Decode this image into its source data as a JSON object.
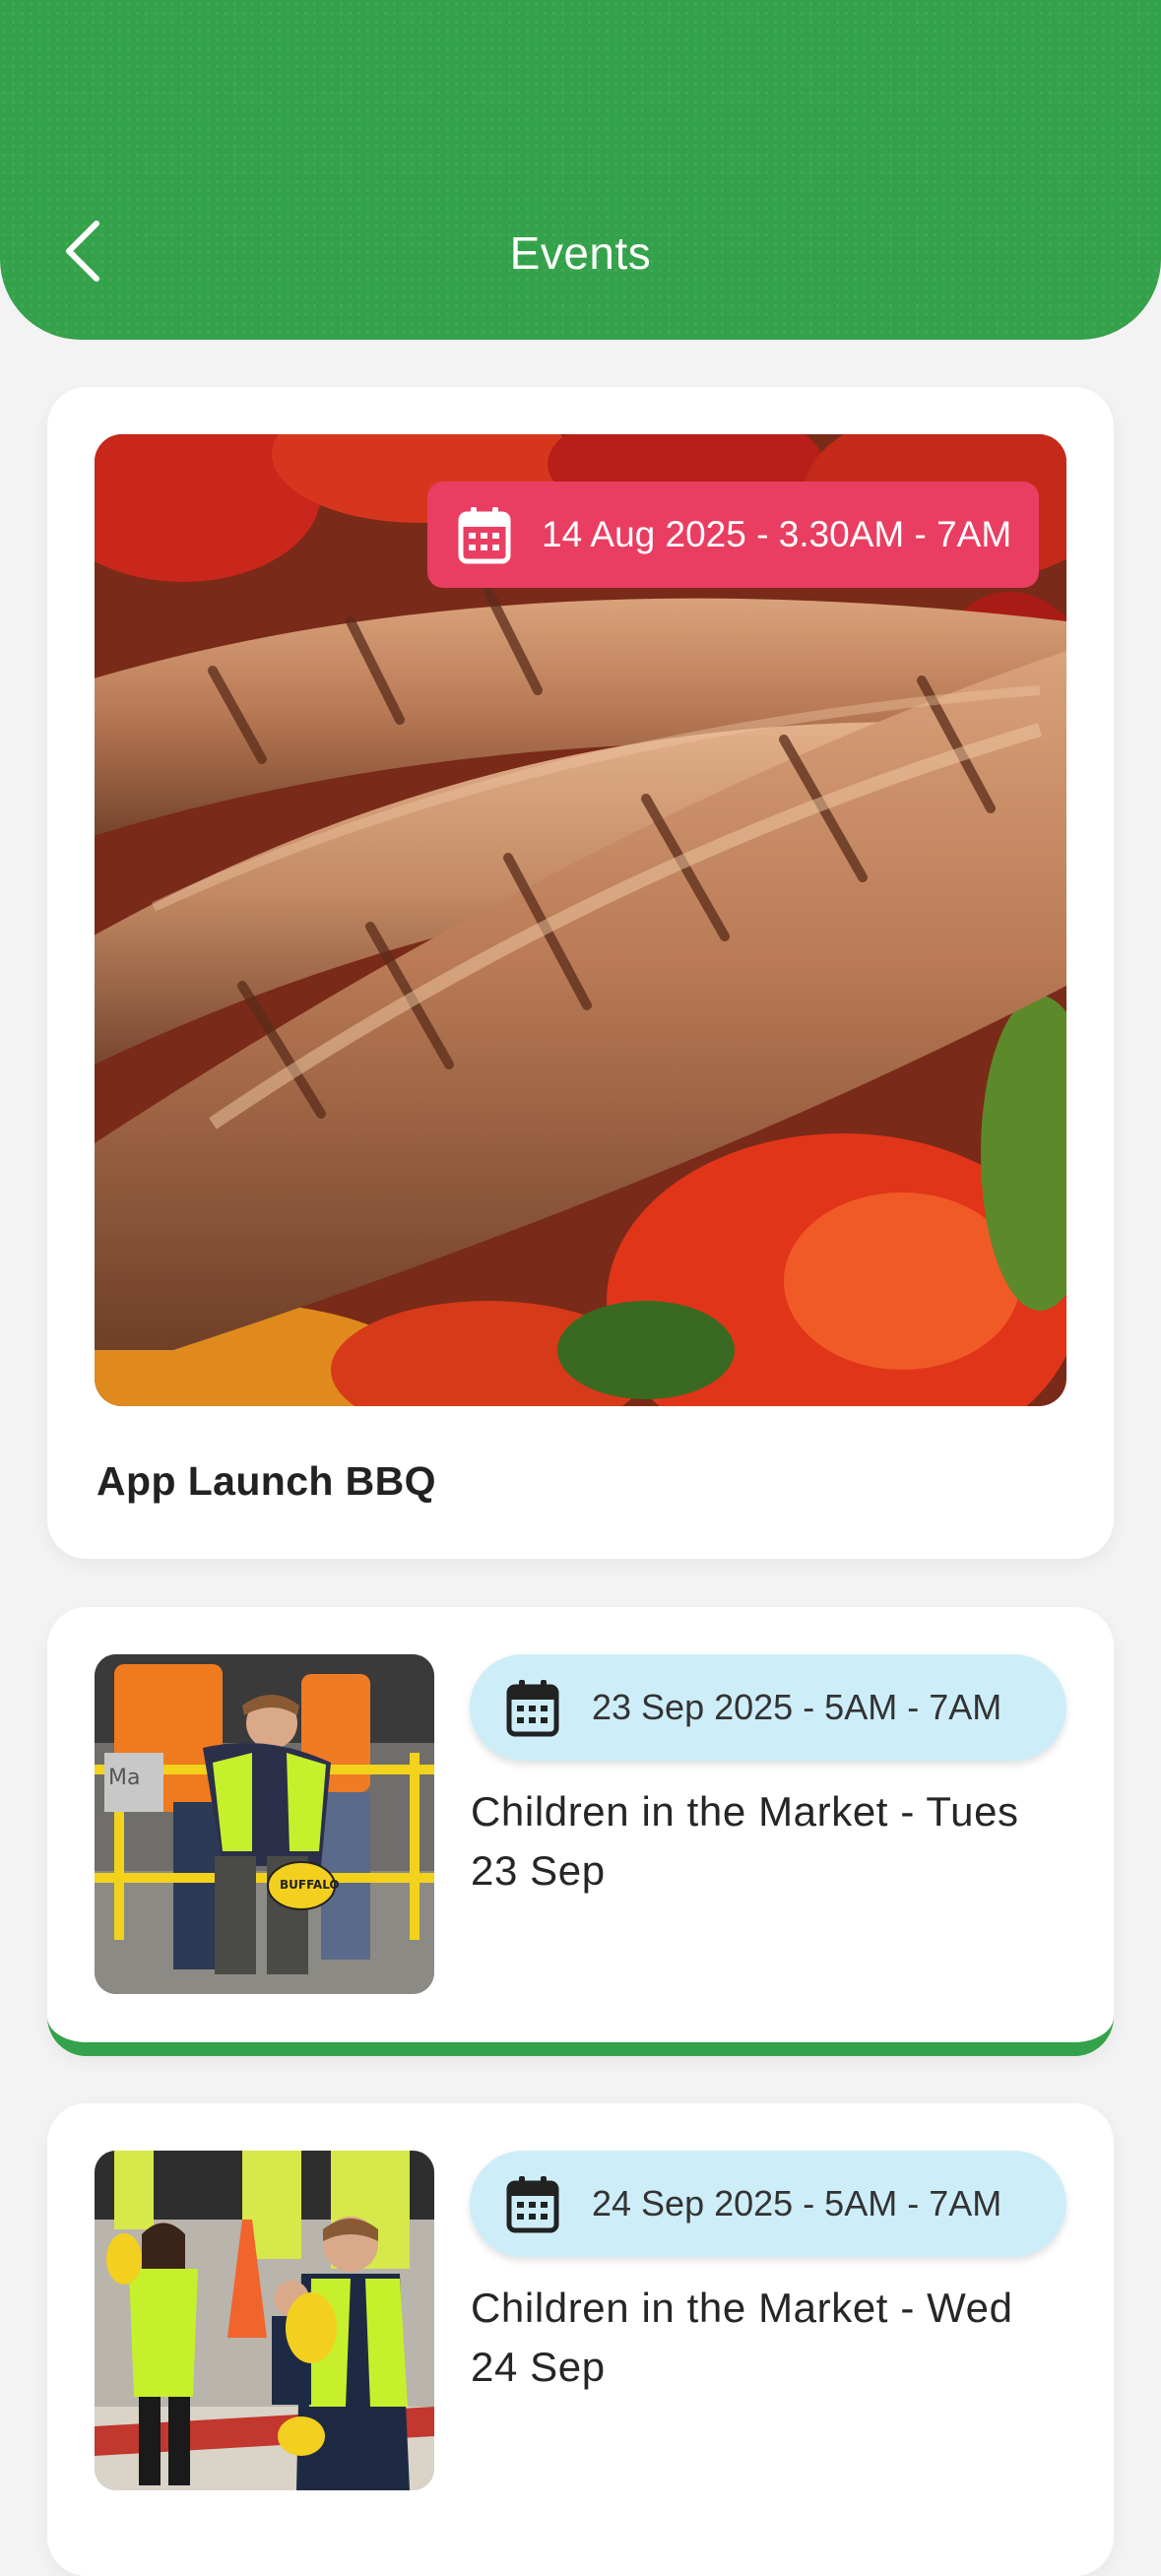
{
  "header": {
    "title": "Events",
    "back_icon": "chevron-left-icon"
  },
  "colors": {
    "brand_green": "#34a24a",
    "badge_pink": "#ea3d62",
    "badge_blue": "#cdeef9"
  },
  "featured_event": {
    "date": "14 Aug 2025 - 3.30AM - 7AM",
    "title": "App Launch BBQ",
    "image": "grilled-sausages-photo",
    "icon": "calendar-icon"
  },
  "events": [
    {
      "date": "23 Sep 2025 - 5AM - 7AM",
      "title": "Children in the Market - Tues 23 Sep",
      "image": "children-market-photo-1",
      "icon": "calendar-icon"
    },
    {
      "date": "24 Sep 2025 - 5AM - 7AM",
      "title": "Children in the Market - Wed 24 Sep",
      "image": "children-market-photo-2",
      "icon": "calendar-icon"
    }
  ]
}
